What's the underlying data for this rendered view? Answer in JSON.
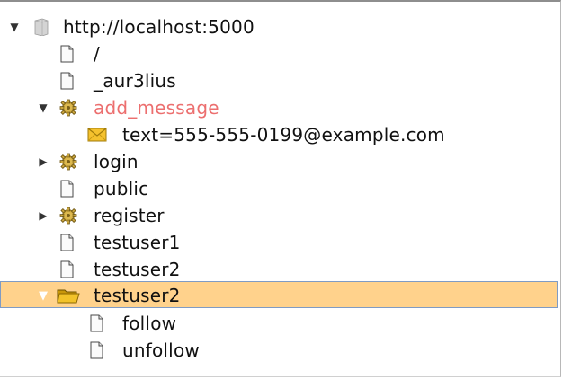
{
  "tree": {
    "root": {
      "label": "http://localhost:5000",
      "icon": "server-icon",
      "expanded": true
    },
    "nodes": [
      {
        "label": "/",
        "icon": "page-icon"
      },
      {
        "label": "_aur3lius",
        "icon": "page-icon"
      },
      {
        "label": "add_message",
        "icon": "gear-icon",
        "expanded": true,
        "highlight_color": "#ec6f6f"
      },
      {
        "label": "text=555-555-0199@example.com",
        "icon": "envelope-icon"
      },
      {
        "label": "login",
        "icon": "gear-icon",
        "expanded": false
      },
      {
        "label": "public",
        "icon": "page-icon"
      },
      {
        "label": "register",
        "icon": "gear-icon",
        "expanded": false
      },
      {
        "label": "testuser1",
        "icon": "page-icon"
      },
      {
        "label": "testuser2",
        "icon": "page-icon"
      },
      {
        "label": "testuser2",
        "icon": "folder-icon",
        "expanded": true,
        "selected": true
      },
      {
        "label": "follow",
        "icon": "page-icon"
      },
      {
        "label": "unfollow",
        "icon": "page-icon"
      }
    ]
  },
  "colors": {
    "selection": "#ffd28c",
    "selection_border": "#7f9bc4"
  }
}
